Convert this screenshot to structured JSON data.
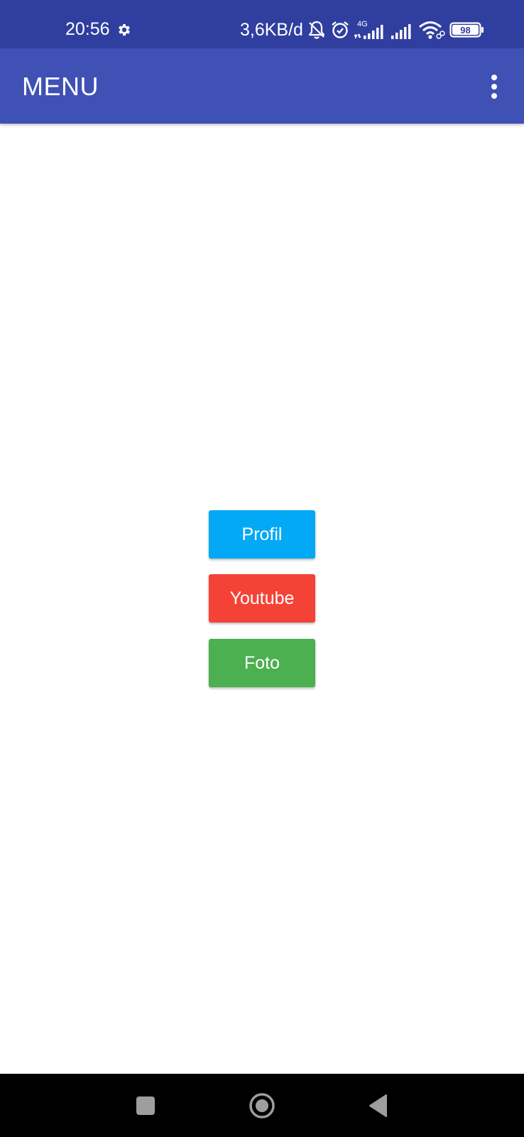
{
  "status_bar": {
    "time": "20:56",
    "network_speed": "3,6KB/d",
    "network_type": "4G",
    "battery": "98",
    "icons": [
      "gear-icon",
      "bell-off-icon",
      "alarm-icon",
      "signal-4g-icon",
      "signal-icon",
      "wifi-icon",
      "battery-icon"
    ]
  },
  "app_bar": {
    "title": "MENU",
    "menu_icon": "more-vert-icon"
  },
  "buttons": [
    {
      "label": "Profil",
      "color": "#03a9f4"
    },
    {
      "label": "Youtube",
      "color": "#f44336"
    },
    {
      "label": "Foto",
      "color": "#4caf50"
    }
  ],
  "nav_bar": {
    "items": [
      "recent-apps-icon",
      "home-icon",
      "back-icon"
    ]
  },
  "colors": {
    "status_bar": "#303f9f",
    "app_bar": "#3f51b5",
    "background": "#ffffff",
    "nav_bar": "#000000"
  }
}
